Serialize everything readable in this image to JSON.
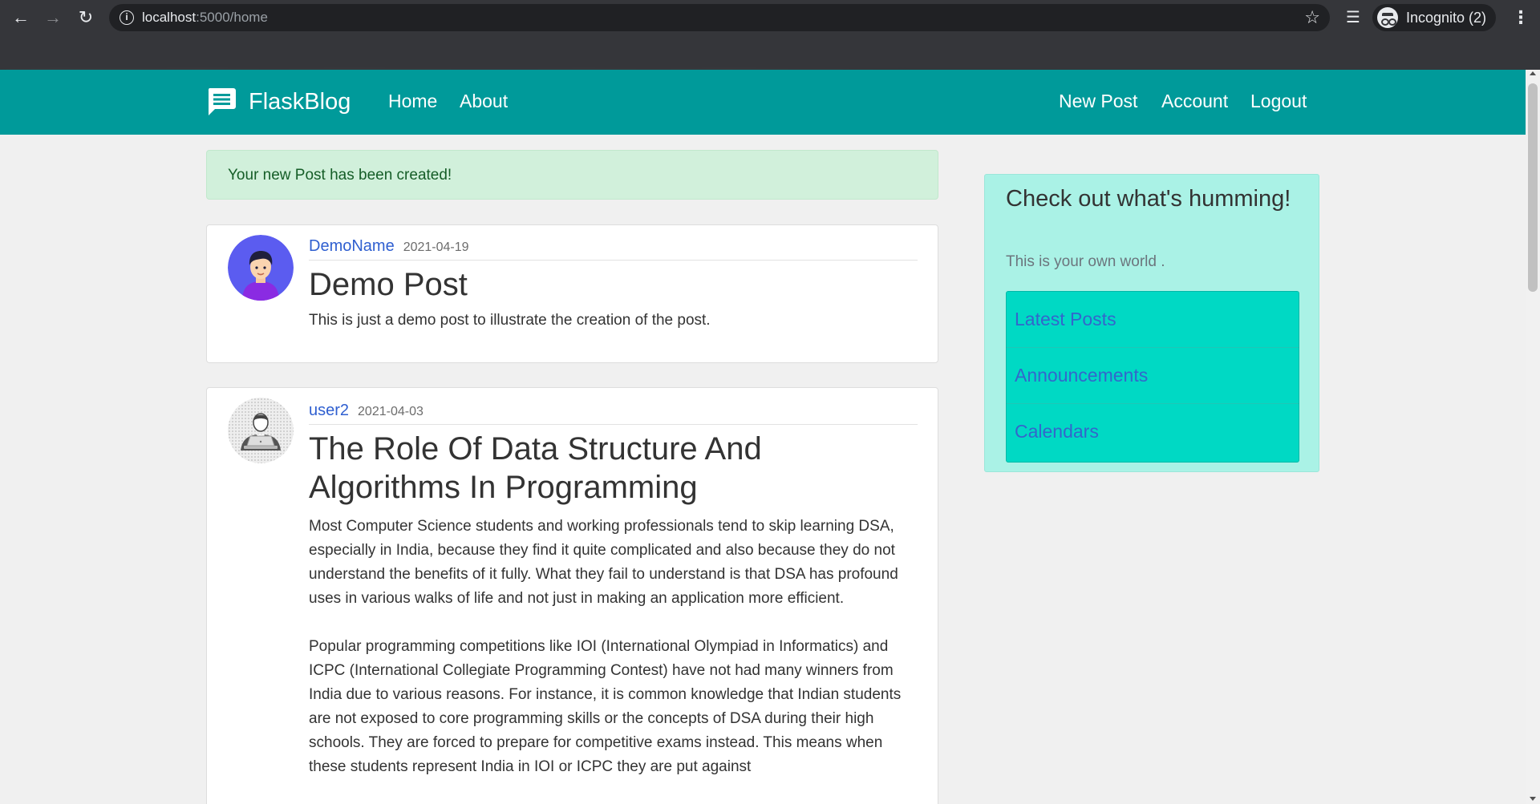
{
  "browser": {
    "url_host": "localhost",
    "url_path": ":5000/home",
    "incognito_label": "Incognito (2)",
    "icons": {
      "back": "arrow-left-icon",
      "forward": "arrow-right-icon",
      "reload": "reload-icon",
      "site_info": "info-icon",
      "bookmark": "star-icon",
      "media": "media-control-icon",
      "incognito": "incognito-icon",
      "menu": "more-vertical-icon"
    }
  },
  "navbar": {
    "brand": "FlaskBlog",
    "brand_icon": "chat-bubble-icon",
    "links_left": [
      "Home",
      "About"
    ],
    "links_right": [
      "New Post",
      "Account",
      "Logout"
    ],
    "color": "#009a9a"
  },
  "alert": {
    "message": "Your new Post has been created!"
  },
  "posts": [
    {
      "author": "DemoName",
      "date": "2021-04-19",
      "title": "Demo Post",
      "paragraphs": [
        "This is just a demo post to illustrate the creation of the post."
      ]
    },
    {
      "author": "user2",
      "date": "2021-04-03",
      "title": "The Role Of Data Structure And Algorithms In Programming",
      "paragraphs": [
        "Most Computer Science students and working professionals tend to skip learning DSA, especially in India, because they find it quite complicated and also because they do not understand the benefits of it fully. What they fail to understand is that DSA has profound uses in various walks of life and not just in making an application more efficient.",
        "Popular programming competitions like IOI (International Olympiad in Informatics) and ICPC (International Collegiate Programming Contest) have not had many winners from India due to various reasons. For instance, it is common knowledge that Indian students are not exposed to core programming skills or the concepts of DSA during their high schools. They are forced to prepare for competitive exams instead. This means when these students represent India in IOI or ICPC they are put against"
      ]
    }
  ],
  "sidebar": {
    "heading": "Check out what's humming!",
    "subtext": "This is your own world .",
    "items": [
      "Latest Posts",
      "Announcements",
      "Calendars"
    ],
    "colors": {
      "panel": "#aaf2e6",
      "list": "#00d9c4",
      "link": "#3366cc"
    }
  }
}
